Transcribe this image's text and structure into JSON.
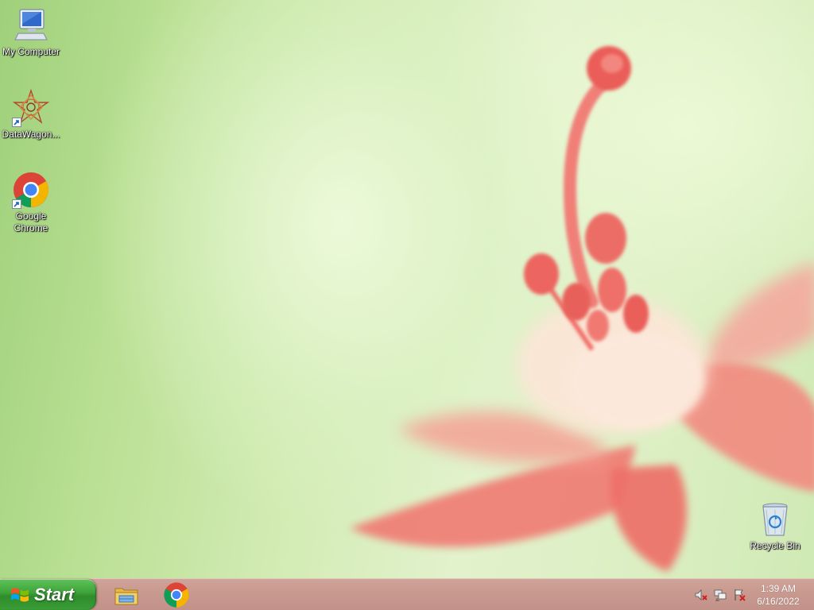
{
  "desktop": {
    "icons": [
      {
        "name": "my-computer",
        "label": "My Computer",
        "icon": "computer-icon"
      },
      {
        "name": "datawagon",
        "label": "DataWagon...",
        "icon": "datawagon-icon"
      },
      {
        "name": "google-chrome",
        "label": "Google Chrome",
        "icon": "chrome-icon"
      },
      {
        "name": "recycle-bin",
        "label": "Recycle Bin",
        "icon": "recycle-bin-icon"
      }
    ]
  },
  "taskbar": {
    "start_label": "Start",
    "pinned": [
      {
        "name": "file-explorer",
        "icon": "folder-icon"
      },
      {
        "name": "chrome",
        "icon": "chrome-icon"
      }
    ],
    "tray": {
      "icons": [
        "volume-muted-icon",
        "network-icon",
        "action-center-icon"
      ],
      "time": "1:39 AM",
      "date": "6/16/2022"
    }
  },
  "colors": {
    "taskbar": "#c99a8f",
    "start_button": "#3ea23a",
    "wallpaper_green": "#cfe9b4",
    "flower_pink": "#f27a72"
  }
}
